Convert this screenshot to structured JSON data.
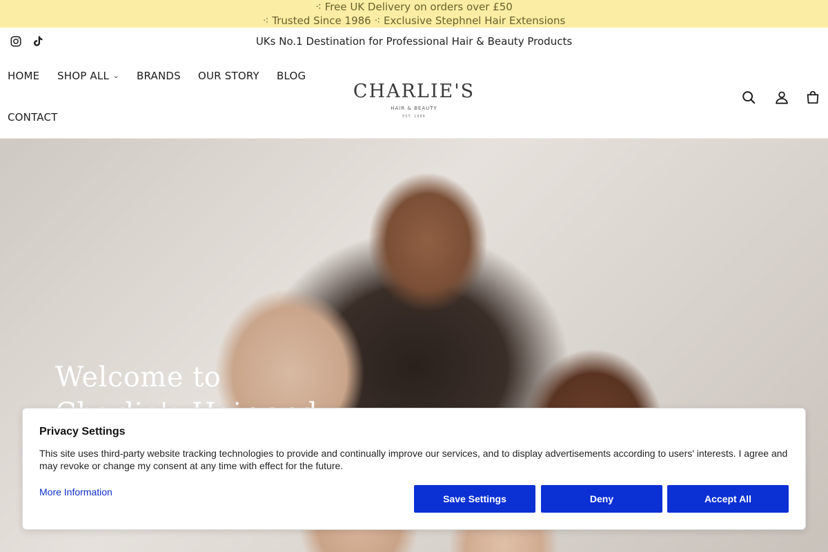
{
  "announcement": {
    "line1": "⁖ Free UK Delivery on orders over £50",
    "line2": "⁖ Trusted Since 1986 ⁖ Exclusive Stephnel Hair Extensions"
  },
  "subbar": {
    "tagline": "UKs No.1 Destination for Professional Hair & Beauty Products",
    "social_icons": [
      "instagram-icon",
      "tiktok-icon"
    ]
  },
  "nav": {
    "items": [
      {
        "label": "HOME"
      },
      {
        "label": "SHOP ALL",
        "has_dropdown": true
      },
      {
        "label": "BRANDS"
      },
      {
        "label": "OUR STORY"
      },
      {
        "label": "BLOG"
      },
      {
        "label": "CONTACT"
      }
    ],
    "dropdown_glyph": "⌄"
  },
  "logo": {
    "name": "CHARLIE'S",
    "subtitle": "HAIR & BEAUTY",
    "est": "EST. 1986"
  },
  "header_icons": [
    "search-icon",
    "account-icon",
    "cart-icon"
  ],
  "hero": {
    "title": "Welcome to",
    "title_continued": "Charlie's Hair and"
  },
  "cookie_banner": {
    "title": "Privacy Settings",
    "text": "This site uses third-party website tracking technologies to provide and continually improve our services, and to display advertisements according to users' interests. I agree and may revoke or change my consent at any time with effect for the future.",
    "more_info": "More Information",
    "buttons": {
      "save": "Save Settings",
      "deny": "Deny",
      "accept": "Accept All"
    }
  },
  "colors": {
    "announcement_bg": "#fbeea4",
    "button_blue": "#0b30d4",
    "link_blue": "#0d2fc9"
  }
}
